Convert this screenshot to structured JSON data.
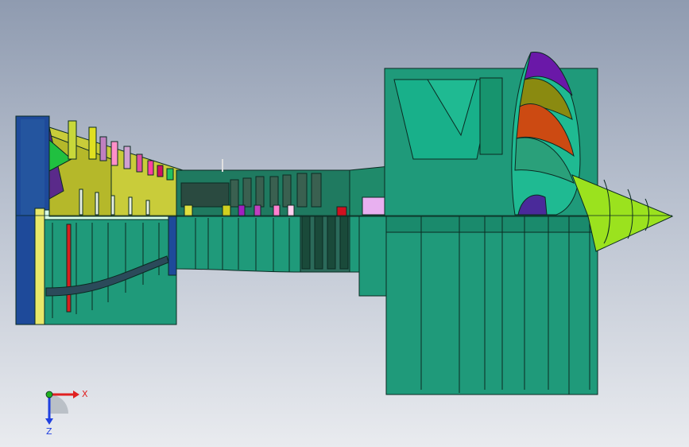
{
  "viewport": {
    "model": "turbofan-engine-section",
    "background_top": "#8f9bb0",
    "background_bottom": "#e9ebef"
  },
  "triad": {
    "x_label": "X",
    "z_label": "Z",
    "x_color": "#e02020",
    "y_color": "#20b020",
    "z_color": "#2040e0"
  },
  "colors": {
    "casing": "#1f9a7a",
    "casing_dark": "#157a5e",
    "outline": "#0b2a22",
    "intake_cone": "#9be21e",
    "fan_blade_orange": "#cc4a12",
    "fan_blade_olive": "#8a8a10",
    "fan_blade_purple": "#6a18a8",
    "rear_cap": "#1e4a9a"
  }
}
